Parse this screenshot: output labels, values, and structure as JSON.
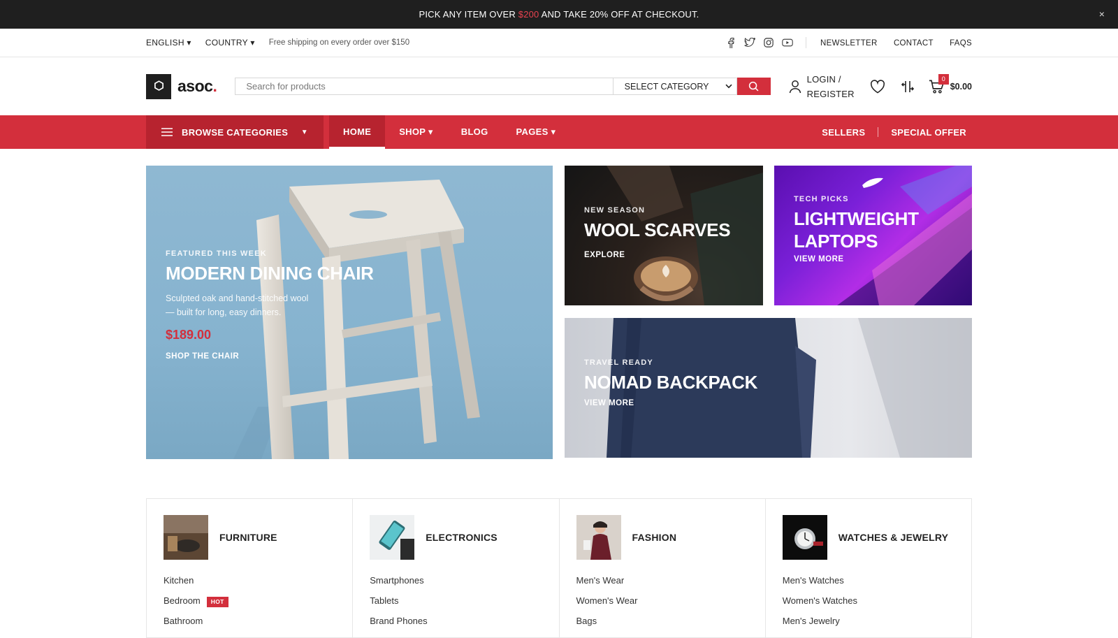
{
  "promo": {
    "text_before": "PICK ANY ITEM OVER ",
    "highlight": "$200",
    "text_after": " AND TAKE 20% OFF AT CHECKOUT.",
    "close_label": "×"
  },
  "topbar": {
    "language": "ENGLISH ▾",
    "country": "COUNTRY ▾",
    "shipping": "Free shipping on every order over $150",
    "social_icons": [
      "facebook-icon",
      "twitter-icon",
      "instagram-icon",
      "youtube-icon"
    ],
    "links": [
      "NEWSLETTER",
      "CONTACT",
      "FAQS"
    ]
  },
  "header": {
    "logo_text": "asoc",
    "logo_dot": ".",
    "search_placeholder": "Search for products",
    "category_select": "SELECT CATEGORY",
    "account_line1": "LOGIN /",
    "account_line2": "REGISTER",
    "cart_count": "0",
    "cart_total": "$0.00"
  },
  "nav": {
    "browse_label": "BROWSE CATEGORIES",
    "browse_caret": "▼",
    "items": [
      "HOME",
      "SHOP ▾",
      "BLOG",
      "PAGES ▾"
    ],
    "active_index": 0,
    "right_links": [
      "SELLERS",
      "SPECIAL OFFER"
    ]
  },
  "hero": {
    "chair": {
      "kicker": "FEATURED THIS WEEK",
      "title": "MODERN DINING CHAIR",
      "desc_line1": "Sculpted oak and hand-stitched wool",
      "desc_line2": "— built for long, easy dinners.",
      "price": "$189.00",
      "cta": "SHOP THE CHAIR"
    },
    "scarf": {
      "kicker": "NEW SEASON",
      "title": "WOOL SCARVES",
      "cta": "EXPLORE"
    },
    "laptop": {
      "kicker": "TECH PICKS",
      "title_line1": "LIGHTWEIGHT",
      "title_line2": "LAPTOPS",
      "cta": "VIEW MORE"
    },
    "bag": {
      "kicker": "TRAVEL READY",
      "title": "NOMAD BACKPACK",
      "cta": "VIEW MORE"
    }
  },
  "categories": [
    {
      "name": "FURNITURE",
      "items": [
        "Kitchen",
        "Bedroom",
        "Bathroom"
      ],
      "hot_item": "Bedroom",
      "hot_label": "HOT"
    },
    {
      "name": "ELECTRONICS",
      "items": [
        "Smartphones",
        "Tablets",
        "Brand Phones"
      ]
    },
    {
      "name": "FASHION",
      "items": [
        "Men's Wear",
        "Women's Wear",
        "Bags"
      ]
    },
    {
      "name": "WATCHES & JEWELRY",
      "items": [
        "Men's Watches",
        "Women's Watches",
        "Men's Jewelry"
      ]
    }
  ],
  "colors": {
    "accent": "#d32f3c",
    "accent_dark": "#b7232f",
    "promo_bg": "#1f1f1f"
  }
}
